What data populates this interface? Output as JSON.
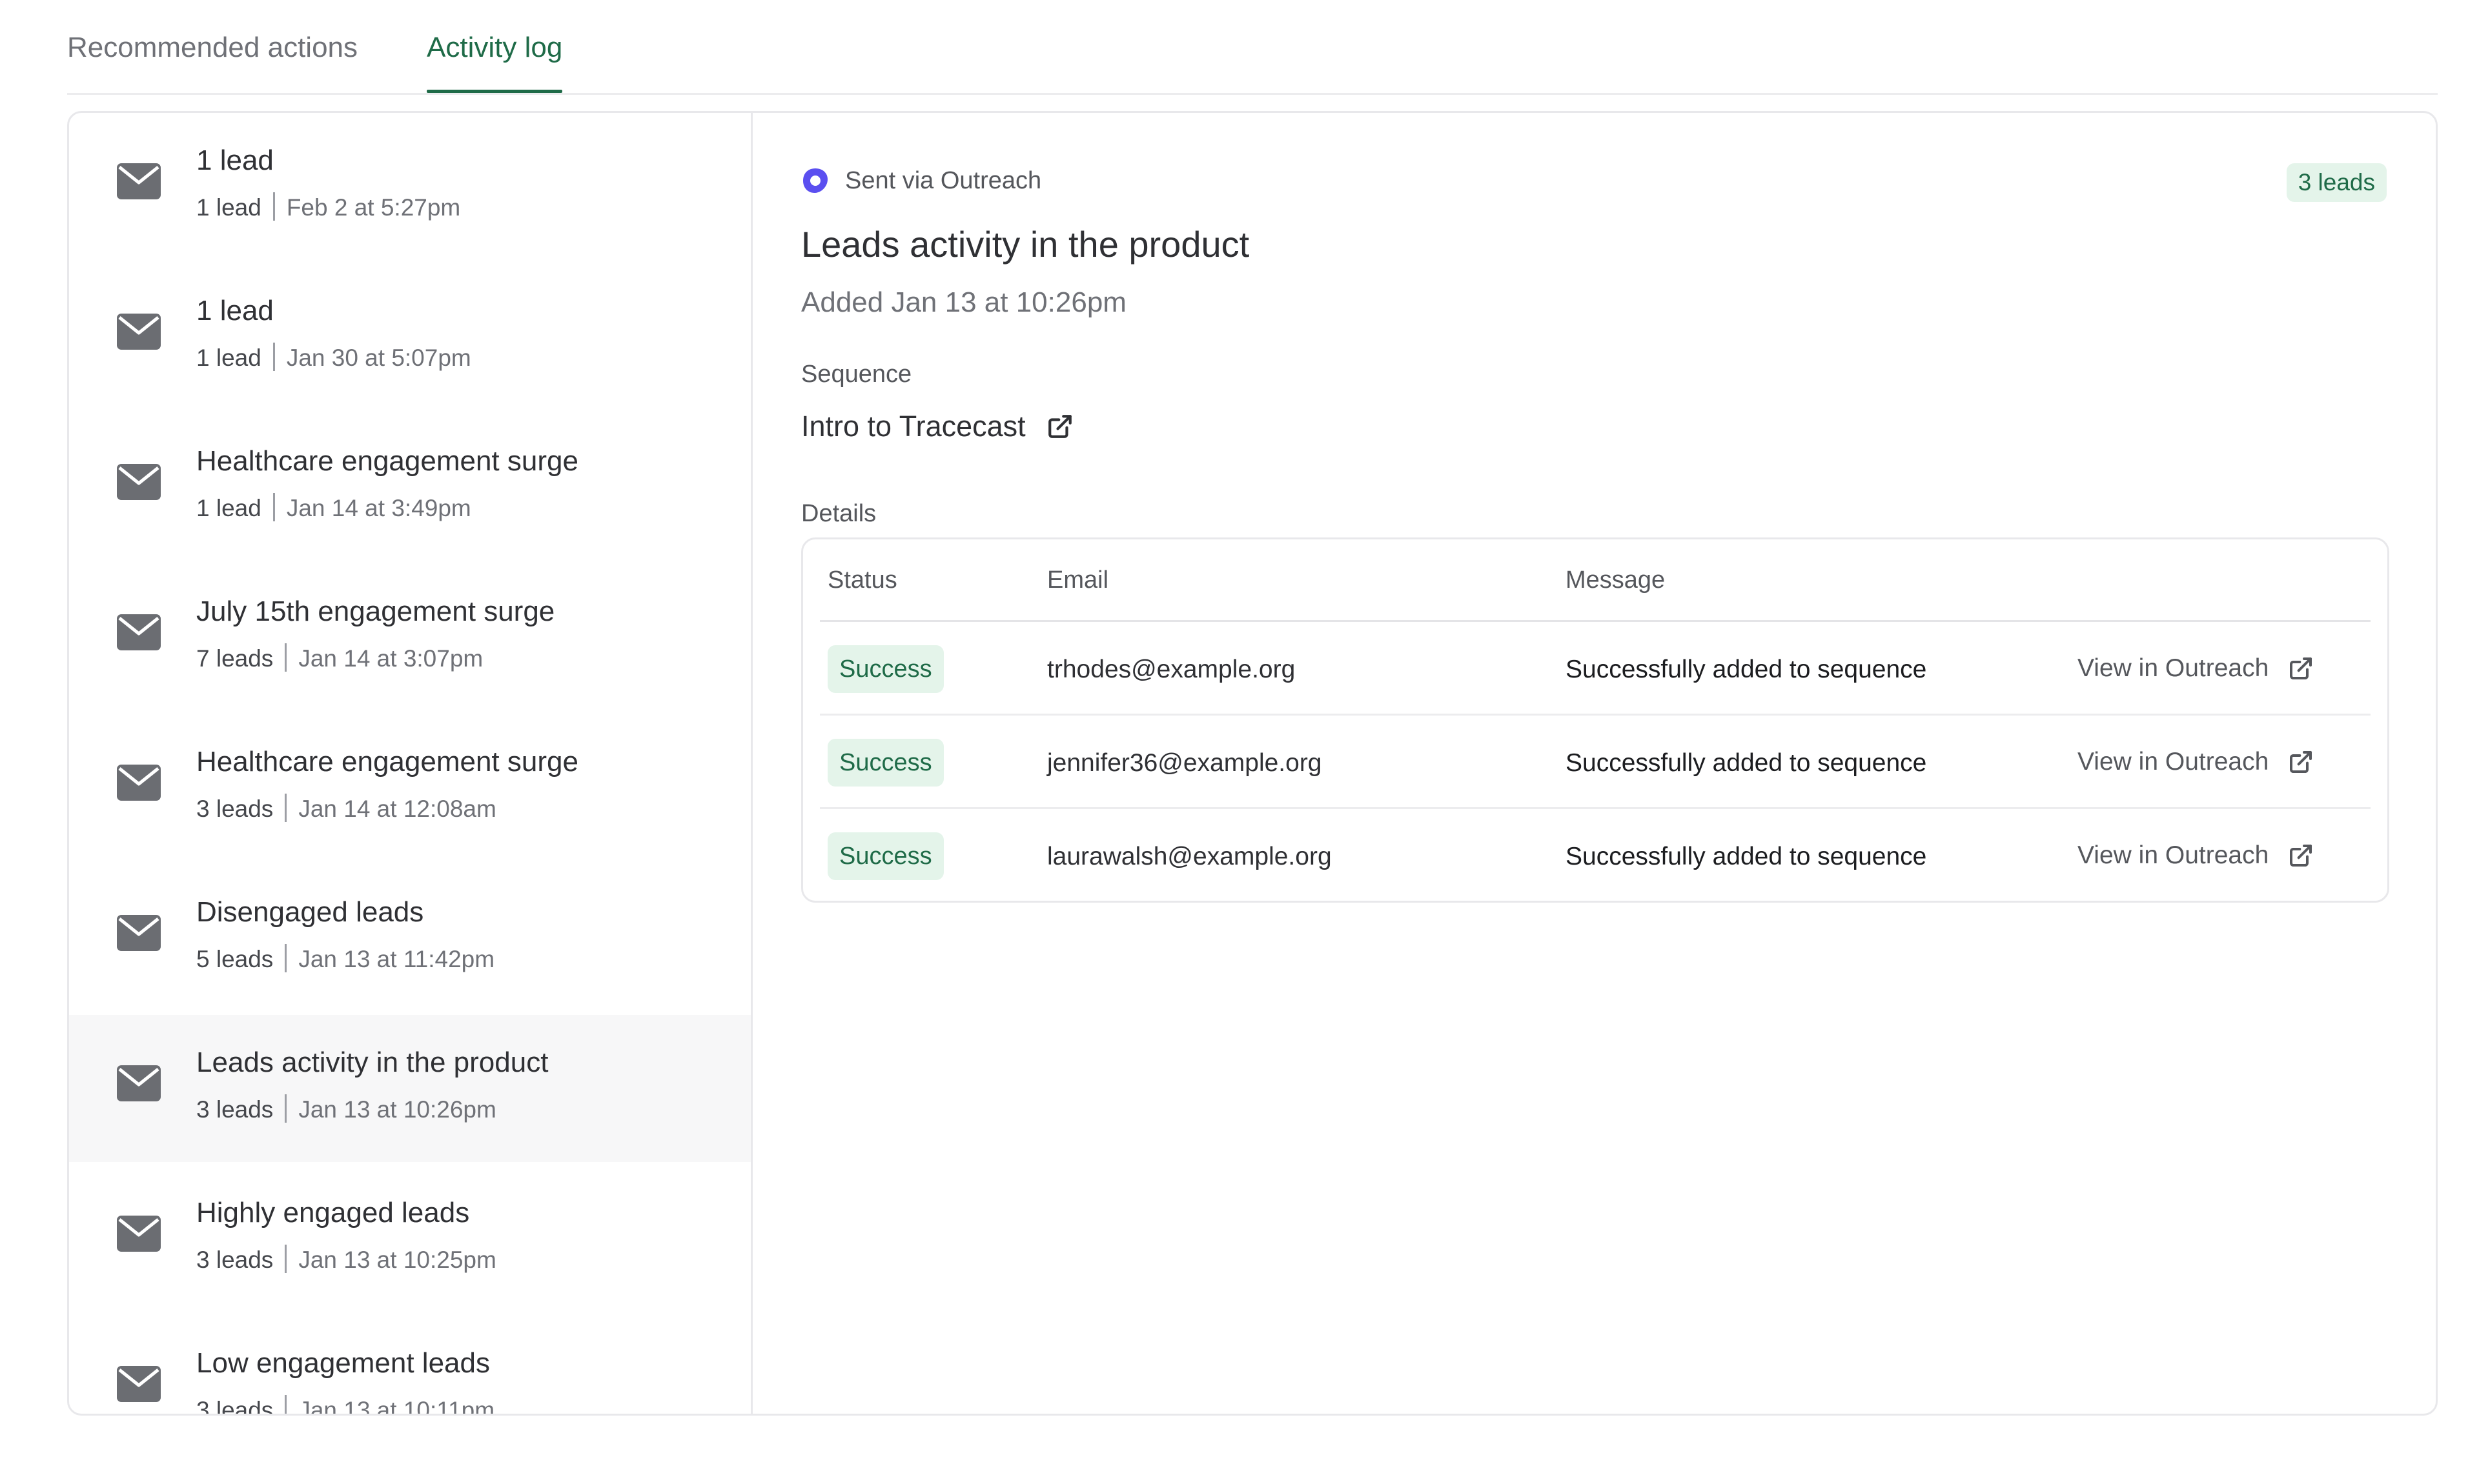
{
  "tabs": [
    {
      "label": "Recommended actions",
      "active": false
    },
    {
      "label": "Activity log",
      "active": true
    }
  ],
  "activity_list": [
    {
      "title": "1 lead",
      "count": "1 lead",
      "date": "Feb 2 at 5:27pm"
    },
    {
      "title": "1 lead",
      "count": "1 lead",
      "date": "Jan 30 at 5:07pm"
    },
    {
      "title": "Healthcare engagement surge",
      "count": "1 lead",
      "date": "Jan 14 at 3:49pm"
    },
    {
      "title": "July 15th engagement surge",
      "count": "7 leads",
      "date": "Jan 14 at 3:07pm"
    },
    {
      "title": "Healthcare engagement surge",
      "count": "3 leads",
      "date": "Jan 14 at 12:08am"
    },
    {
      "title": "Disengaged leads",
      "count": "5 leads",
      "date": "Jan 13 at 11:42pm"
    },
    {
      "title": "Leads activity in the product",
      "count": "3 leads",
      "date": "Jan 13 at 10:26pm",
      "selected": true
    },
    {
      "title": "Highly engaged leads",
      "count": "3 leads",
      "date": "Jan 13 at 10:25pm"
    },
    {
      "title": "Low engagement leads",
      "count": "3 leads",
      "date": "Jan 13 at 10:11pm"
    }
  ],
  "detail": {
    "source": "Sent via Outreach",
    "lead_count": "3 leads",
    "title": "Leads activity in the product",
    "added": "Added Jan 13 at 10:26pm",
    "sequence_label": "Sequence",
    "sequence_name": "Intro to Tracecast",
    "details_label": "Details",
    "table": {
      "headers": {
        "status": "Status",
        "email": "Email",
        "message": "Message"
      },
      "rows": [
        {
          "status": "Success",
          "email": "trhodes@example.org",
          "message": "Successfully added to sequence",
          "action": "View in Outreach"
        },
        {
          "status": "Success",
          "email": "jennifer36@example.org",
          "message": "Successfully added to sequence",
          "action": "View in Outreach"
        },
        {
          "status": "Success",
          "email": "laurawalsh@example.org",
          "message": "Successfully added to sequence",
          "action": "View in Outreach"
        }
      ]
    }
  },
  "colors": {
    "accent_green": "#1f6b48",
    "success_bg": "#e4f4ea",
    "outreach_purple": "#5b4ff0",
    "icon_gray": "#6b6d72"
  },
  "icons": {
    "list_item": "envelope-icon",
    "source": "outreach-logo-icon",
    "external": "external-link-icon"
  }
}
